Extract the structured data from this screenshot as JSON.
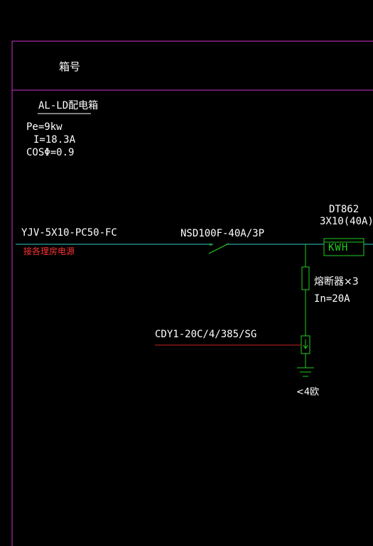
{
  "colors": {
    "background": "#000000",
    "frame": "#cc33cc",
    "busbar": "#33cccc",
    "circuit": "#22cc22",
    "cable": "#cc2222",
    "label": "#ffffff",
    "source_note": "#ff3333"
  },
  "header": {
    "box_label": "箱号"
  },
  "panel": {
    "name": "AL-LD配电箱",
    "pe": "Pe=9kw",
    "current": "I=18.3A",
    "power_factor": "COSΦ=0.9"
  },
  "incoming": {
    "cable": "YJV-5X10-PC50-FC",
    "source_note": "接各理房电源"
  },
  "breaker": {
    "label": "NSD100F-40A/3P"
  },
  "meter": {
    "model": "DT862",
    "rating": "3X10(40A)",
    "symbol_text": "KWH"
  },
  "fuse": {
    "label": "熔断器×3",
    "rating": "In=20A"
  },
  "surge_protector": {
    "label": "CDY1-20C/4/385/SG"
  },
  "ground": {
    "resistance": "<4欧"
  }
}
